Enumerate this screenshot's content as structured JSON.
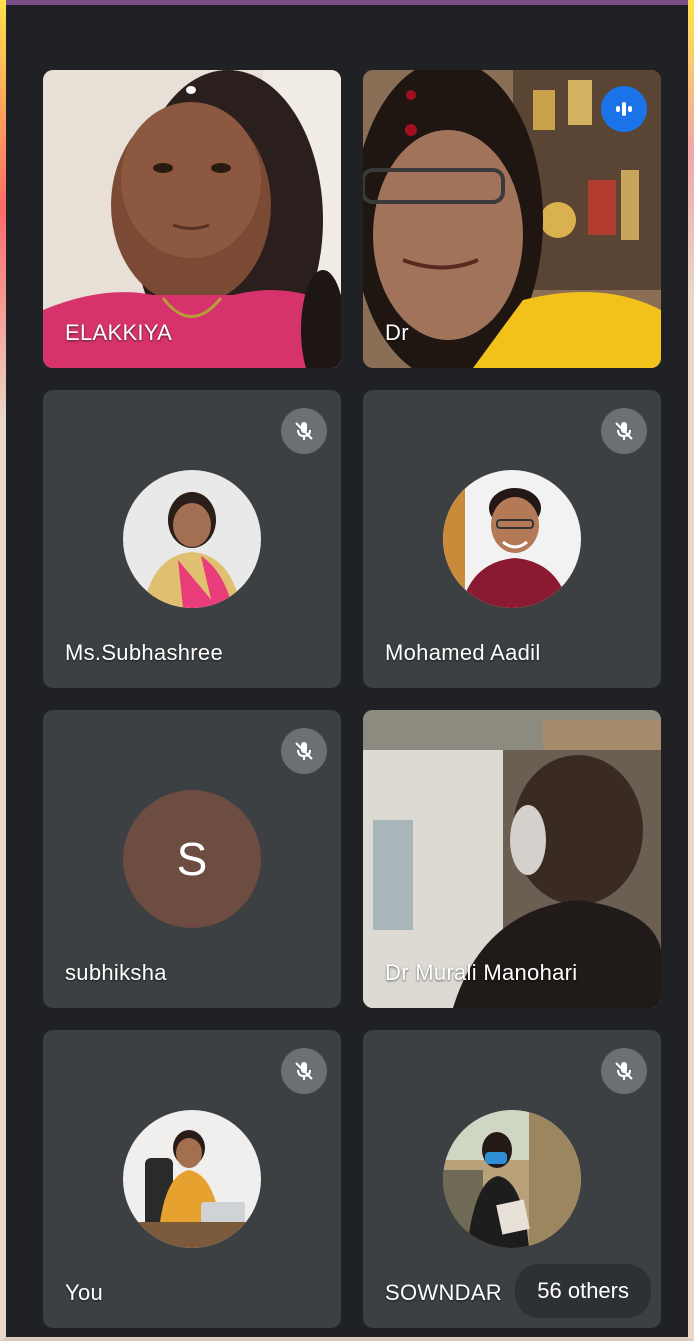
{
  "participants": [
    {
      "name": "ELAKKIYA"
    },
    {
      "name": "Dr"
    },
    {
      "name": "Ms.Subhashree"
    },
    {
      "name": "Mohamed Aadil"
    },
    {
      "name": "subhiksha",
      "initial": "S"
    },
    {
      "name": "Dr Murali Manohari"
    },
    {
      "name": "You"
    },
    {
      "name": "SOWNDAR"
    }
  ],
  "others_label": "56 others",
  "colors": {
    "tile_bg": "#3c4043",
    "page_bg": "#202124",
    "speaking": "#1a73e8",
    "letter_avatar": "#6d4c41"
  },
  "icons": {
    "muted": "mic-off-icon",
    "speaking": "audio-level-icon"
  }
}
